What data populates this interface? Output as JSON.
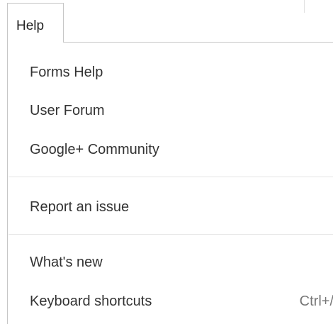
{
  "menubar": {
    "active_tab_label": "Help"
  },
  "help_menu": {
    "items": [
      {
        "label": "Forms Help"
      },
      {
        "label": "User Forum"
      },
      {
        "label": "Google+ Community"
      },
      {
        "label": "Report an issue"
      },
      {
        "label": "What's new"
      },
      {
        "label": "Keyboard shortcuts",
        "shortcut": "Ctrl+/"
      }
    ]
  }
}
